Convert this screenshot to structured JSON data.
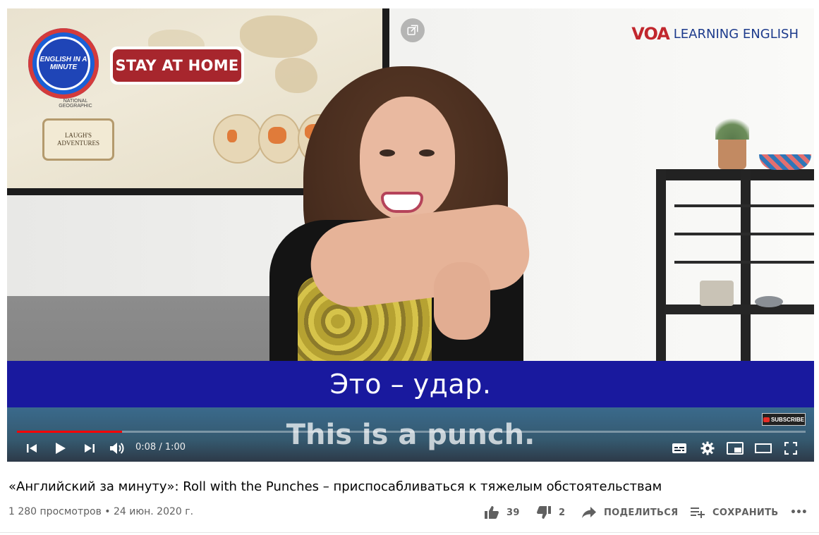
{
  "video": {
    "logo_badge_text": "ENGLISH IN A MINUTE",
    "map_caption": "NATIONAL GEOGRAPHIC",
    "certificate_text": "LAUGH'S ADVENTURES",
    "stay_home_text": "STAY AT HOME",
    "brand_mark": "VOA",
    "brand_text": "LEARNING ENGLISH",
    "caption_ru": "Это – удар.",
    "caption_en": "This is a punch.",
    "subscribe_badge": "SUBSCRIBE"
  },
  "player": {
    "current_time": "0:08",
    "duration": "1:00",
    "time_display": "0:08 / 1:00",
    "progress_fraction": 0.1333,
    "accent_color": "#ff0000",
    "caption_band_color": "#19199e",
    "controls": {
      "prev": "skip-previous-icon",
      "play": "play-icon",
      "next": "skip-next-icon",
      "volume": "volume-icon",
      "subtitles": "subtitles-icon",
      "settings": "gear-icon",
      "miniplayer": "miniplayer-icon",
      "theater": "theater-mode-icon",
      "fullscreen": "fullscreen-icon",
      "pip_top": "picture-in-picture-icon"
    }
  },
  "info": {
    "title": "«Английский за минуту»: Roll with the Punches – приспосабливаться к тяжелым обстоятельствам",
    "views_date": "1 280 просмотров • 24 июн. 2020 г.",
    "likes": "39",
    "dislikes": "2",
    "share_label": "ПОДЕЛИТЬСЯ",
    "save_label": "СОХРАНИТЬ",
    "more_label": "•••"
  }
}
